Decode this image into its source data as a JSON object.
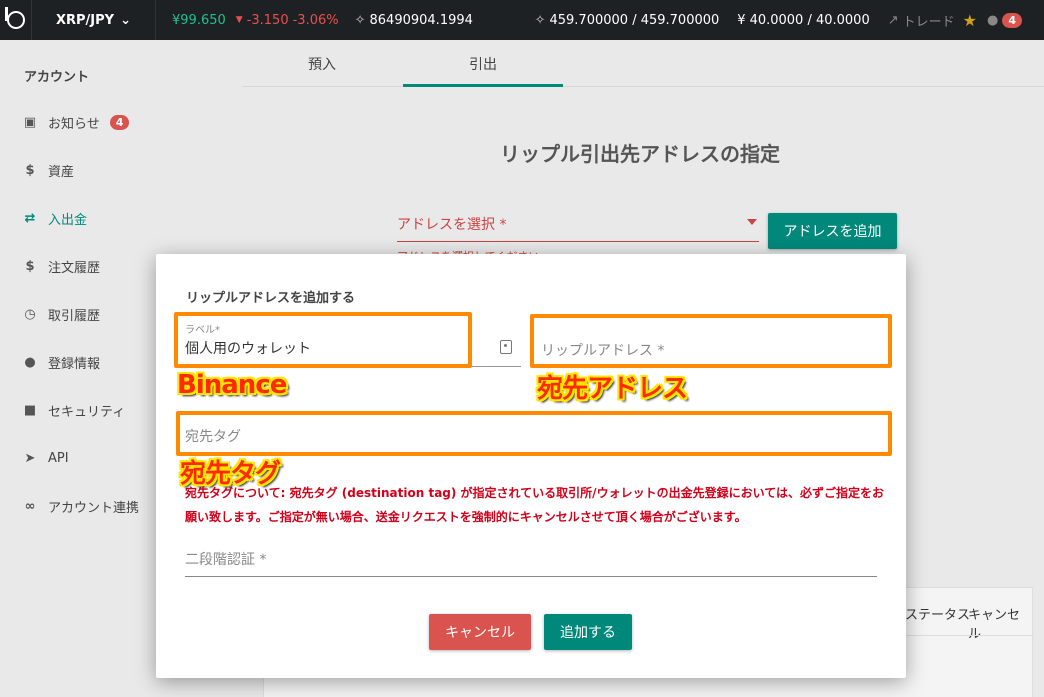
{
  "topbar": {
    "pair": "XRP/JPY",
    "price": "¥99.650",
    "change": "-3.150",
    "change_pct": "-3.06%",
    "volume": "86490904.1994",
    "xrp_balance": "459.700000 / 459.700000",
    "jpy_balance": "40.0000 / 40.0000",
    "trade_label": "トレード",
    "notification_count": "4"
  },
  "sidebar": {
    "title": "アカウント",
    "items": [
      {
        "label": "お知らせ",
        "badge": "4"
      },
      {
        "label": "資産"
      },
      {
        "label": "入出金"
      },
      {
        "label": "注文履歴"
      },
      {
        "label": "取引履歴"
      },
      {
        "label": "登録情報"
      },
      {
        "label": "セキュリティ"
      },
      {
        "label": "API"
      },
      {
        "label": "アカウント連携"
      }
    ]
  },
  "main": {
    "tabs": [
      "預入",
      "引出"
    ],
    "heading": "リップル引出先アドレスの指定",
    "address_select_placeholder": "アドレスを選択 *",
    "add_address_button": "アドレスを追加",
    "address_error": "アドレスを選択してください",
    "table_columns": [
      "ステータス",
      "キャンセル"
    ]
  },
  "modal": {
    "title": "リップルアドレスを追加する",
    "label_field_label": "ラベル*",
    "label_field_value": "個人用のウォレット",
    "xrp_address_placeholder": "リップルアドレス *",
    "destination_tag_placeholder": "宛先タグ",
    "notice": "宛先タグについて: 宛先タグ (destination tag) が指定されている取引所/ウォレットの出金先登録においては、必ずご指定をお願い致します。ご指定が無い場合、送金リクエストを強制的にキャンセルさせて頂く場合がございます。",
    "twofa_placeholder": "二段階認証 *",
    "cancel_button": "キャンセル",
    "add_button": "追加する"
  },
  "annotations": {
    "label_note": "Binance",
    "address_note": "宛先アドレス",
    "tag_note": "宛先タグ"
  },
  "colors": {
    "accent": "#00897b",
    "danger": "#d9534f",
    "highlight": "#ff8a00"
  }
}
